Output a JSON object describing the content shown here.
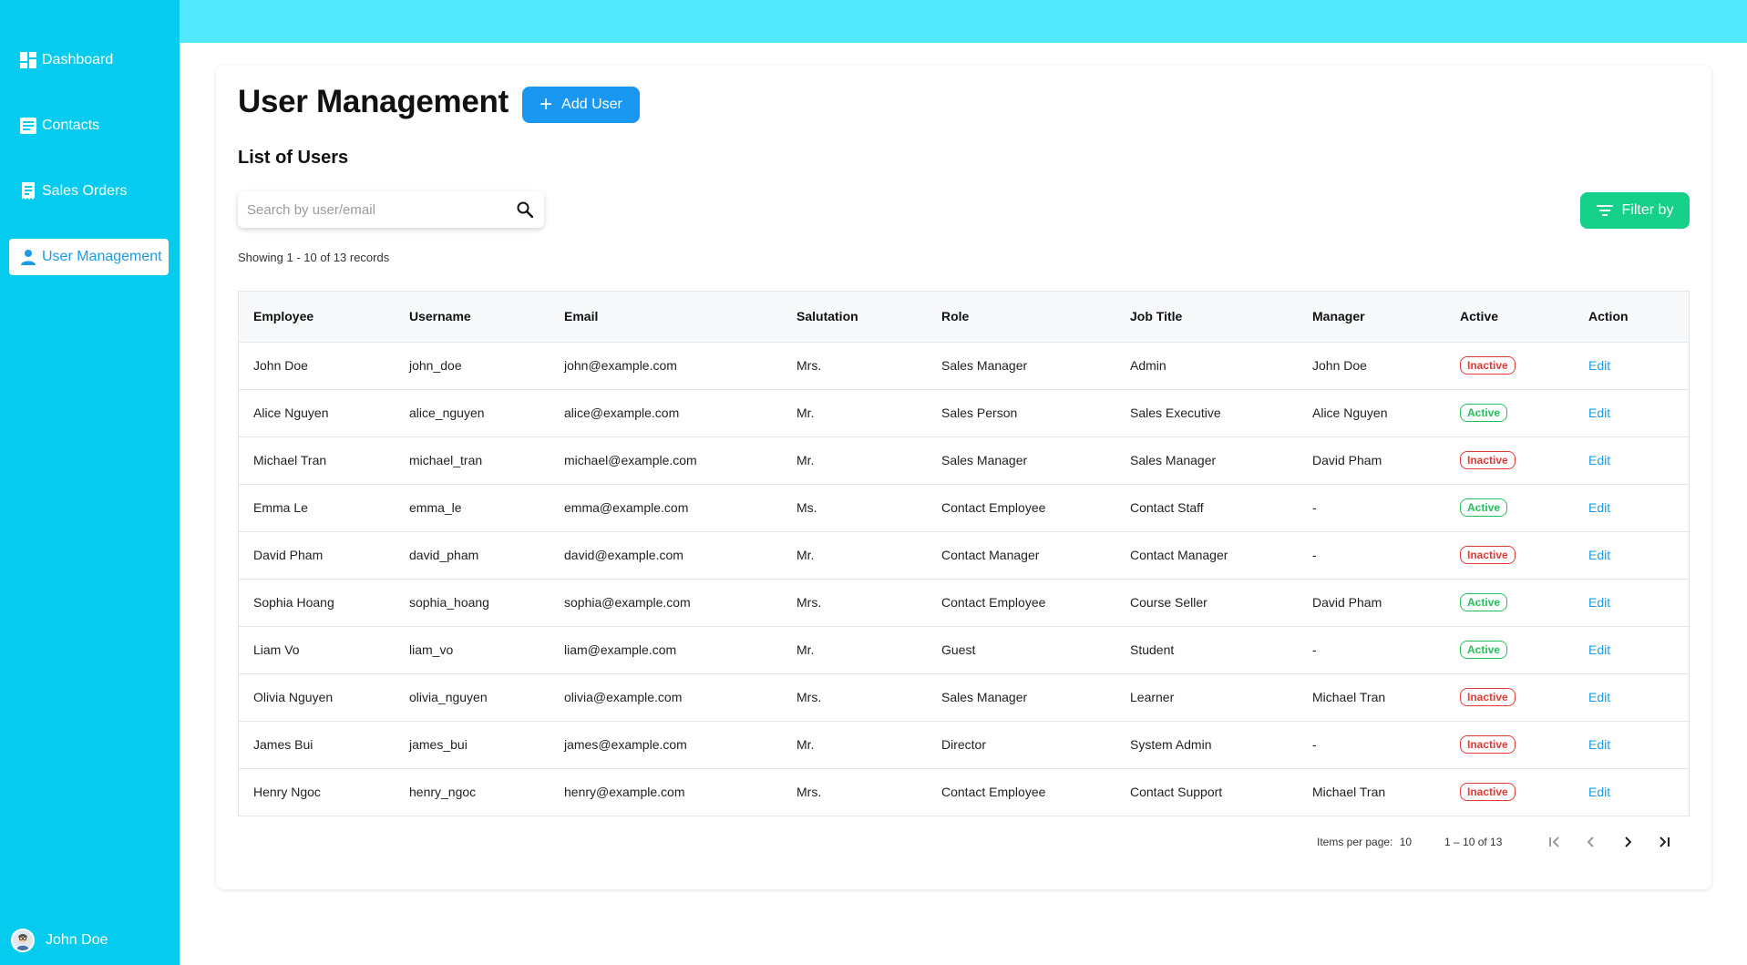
{
  "sidebar": {
    "items": [
      {
        "label": "Dashboard",
        "icon": "dashboard-icon"
      },
      {
        "label": "Contacts",
        "icon": "contacts-icon"
      },
      {
        "label": "Sales Orders",
        "icon": "sales-orders-icon"
      },
      {
        "label": "User Management",
        "icon": "user-icon"
      }
    ],
    "active_item": "User Management",
    "user_name": "John Doe"
  },
  "colors": {
    "sidebar_bg": "#05cbee",
    "topbar_bg": "#52e8fb",
    "primary": "#1a97f0",
    "filter_green": "#14d088",
    "active_green": "#20c15a",
    "inactive_red": "#e53935"
  },
  "main": {
    "title": "User Management",
    "add_button_label": "Add User",
    "subtitle": "List of Users",
    "search_placeholder": "Search by user/email",
    "search_value": "",
    "filter_button_label": "Filter by",
    "records_text": "Showing 1 - 10 of 13 records"
  },
  "table": {
    "columns": [
      "Employee",
      "Username",
      "Email",
      "Salutation",
      "Role",
      "Job Title",
      "Manager",
      "Active",
      "Action"
    ],
    "rows": [
      {
        "employee": "John Doe",
        "username": "john_doe",
        "email": "john@example.com",
        "salutation": "Mrs.",
        "role": "Sales Manager",
        "job_title": "Admin",
        "manager": "John Doe",
        "status": "Inactive",
        "action": "Edit"
      },
      {
        "employee": "Alice Nguyen",
        "username": "alice_nguyen",
        "email": "alice@example.com",
        "salutation": "Mr.",
        "role": "Sales Person",
        "job_title": "Sales Executive",
        "manager": "Alice Nguyen",
        "status": "Active",
        "action": "Edit"
      },
      {
        "employee": "Michael Tran",
        "username": "michael_tran",
        "email": "michael@example.com",
        "salutation": "Mr.",
        "role": "Sales Manager",
        "job_title": "Sales Manager",
        "manager": "David Pham",
        "status": "Inactive",
        "action": "Edit"
      },
      {
        "employee": "Emma Le",
        "username": "emma_le",
        "email": "emma@example.com",
        "salutation": "Ms.",
        "role": "Contact Employee",
        "job_title": "Contact Staff",
        "manager": "-",
        "status": "Active",
        "action": "Edit"
      },
      {
        "employee": "David Pham",
        "username": "david_pham",
        "email": "david@example.com",
        "salutation": "Mr.",
        "role": "Contact Manager",
        "job_title": "Contact Manager",
        "manager": "-",
        "status": "Inactive",
        "action": "Edit"
      },
      {
        "employee": "Sophia Hoang",
        "username": "sophia_hoang",
        "email": "sophia@example.com",
        "salutation": "Mrs.",
        "role": "Contact Employee",
        "job_title": "Course Seller",
        "manager": "David Pham",
        "status": "Active",
        "action": "Edit"
      },
      {
        "employee": "Liam Vo",
        "username": "liam_vo",
        "email": "liam@example.com",
        "salutation": "Mr.",
        "role": "Guest",
        "job_title": "Student",
        "manager": "-",
        "status": "Active",
        "action": "Edit"
      },
      {
        "employee": "Olivia Nguyen",
        "username": "olivia_nguyen",
        "email": "olivia@example.com",
        "salutation": "Mrs.",
        "role": "Sales Manager",
        "job_title": "Learner",
        "manager": "Michael Tran",
        "status": "Inactive",
        "action": "Edit"
      },
      {
        "employee": "James Bui",
        "username": "james_bui",
        "email": "james@example.com",
        "salutation": "Mr.",
        "role": "Director",
        "job_title": "System Admin",
        "manager": "-",
        "status": "Inactive",
        "action": "Edit"
      },
      {
        "employee": "Henry Ngoc",
        "username": "henry_ngoc",
        "email": "henry@example.com",
        "salutation": "Mrs.",
        "role": "Contact Employee",
        "job_title": "Contact Support",
        "manager": "Michael Tran",
        "status": "Inactive",
        "action": "Edit"
      }
    ]
  },
  "pagination": {
    "items_per_page_label": "Items per page:",
    "items_per_page_value": "10",
    "range_text": "1 – 10 of 13",
    "buttons": [
      "first-page-icon",
      "previous-page-icon",
      "next-page-icon",
      "last-page-icon"
    ]
  }
}
